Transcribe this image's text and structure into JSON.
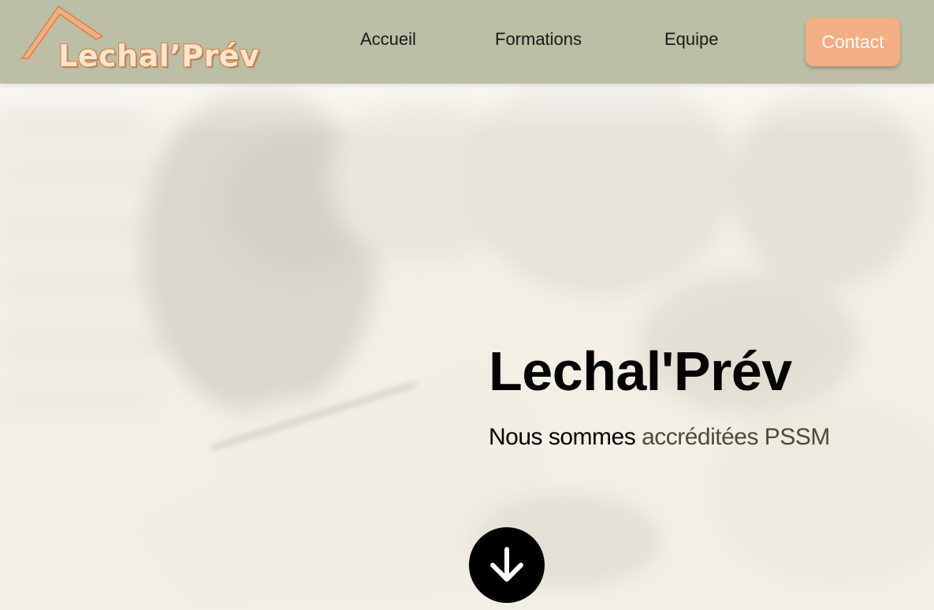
{
  "brand": {
    "logo_text": "Lechal’Prév"
  },
  "nav": {
    "items": [
      {
        "label": "Accueil"
      },
      {
        "label": "Formations"
      },
      {
        "label": "Equipe"
      }
    ],
    "contact_label": "Contact"
  },
  "hero": {
    "title": "Lechal'Prév",
    "subtitle_plain": "Nous sommes ",
    "subtitle_accent": "accréditées PSSM",
    "scroll_icon": "arrow-down-icon"
  },
  "colors": {
    "header_bg": "#bcbea5",
    "contact_bg": "#f2ae85",
    "logo_orange": "#f2ae85",
    "accent_text": "#4a4d35",
    "hero_overlay": "#fbf7ee"
  }
}
